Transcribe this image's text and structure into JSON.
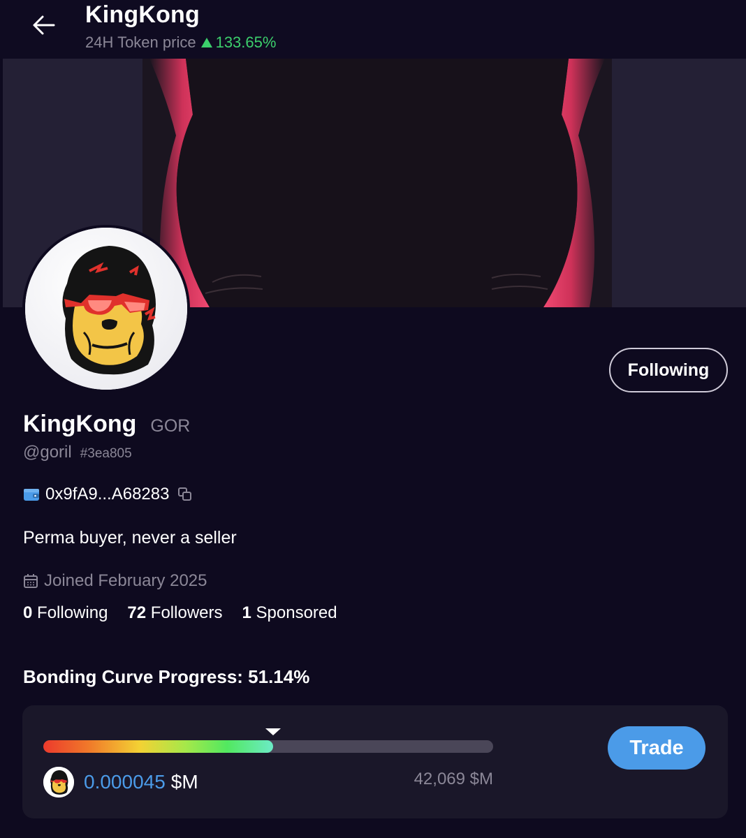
{
  "header": {
    "title": "KingKong",
    "subtitle_label": "24H Token price",
    "price_change": "133.65%"
  },
  "profile": {
    "name": "KingKong",
    "ticker": "GOR",
    "handle": "@goril",
    "hash": "#3ea805",
    "wallet_address": "0x9fA9...A68283",
    "bio": "Perma buyer, never a seller",
    "joined": "Joined February 2025",
    "follow_button_label": "Following"
  },
  "stats": [
    {
      "count": "0",
      "label": "Following"
    },
    {
      "count": "72",
      "label": "Followers"
    },
    {
      "count": "1",
      "label": "Sponsored"
    }
  ],
  "bonding_curve": {
    "title": "Bonding Curve Progress: 51.14%",
    "progress_percent": 51.14,
    "current_price": "0.000045",
    "current_unit": "$M",
    "target": "42,069 $M",
    "trade_label": "Trade"
  },
  "colors": {
    "background": "#0e0a1f",
    "accent_blue": "#4b9be8",
    "positive_green": "#3ccf6c",
    "muted_text": "#8b8797"
  }
}
